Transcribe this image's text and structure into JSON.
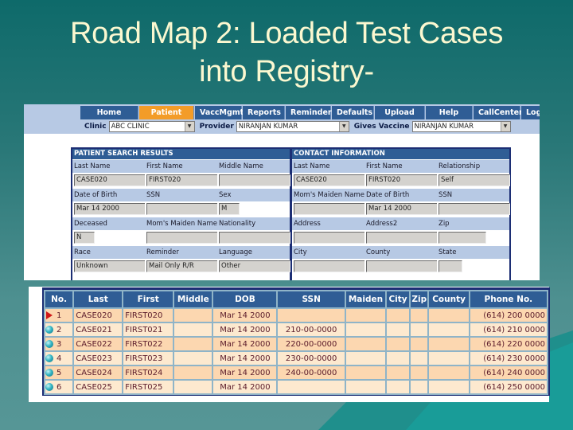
{
  "slide": {
    "title_line1": "Road Map 2: Loaded Test Cases",
    "title_line2": "into Registry-"
  },
  "app": {
    "nav": [
      {
        "label": "Home",
        "active": false
      },
      {
        "label": "Patient",
        "active": true
      },
      {
        "label": "VaccMgmt",
        "active": false
      },
      {
        "label": "Reports",
        "active": false
      },
      {
        "label": "Reminder",
        "active": false
      },
      {
        "label": "Defaults",
        "active": false
      },
      {
        "label": "Upload",
        "active": false
      },
      {
        "label": "Help",
        "active": false
      },
      {
        "label": "CallCenter",
        "active": false
      },
      {
        "label": "Logout",
        "active": false
      }
    ],
    "filters": {
      "clinic_label": "Clinic",
      "clinic_value": "ABC CLINIC",
      "provider_label": "Provider",
      "provider_value": "NIRANJAN KUMAR",
      "gives_vaccine_label": "Gives Vaccine",
      "gives_vaccine_value": "NIRANJAN KUMAR"
    },
    "patient_panel": {
      "title": "PATIENT SEARCH RESULTS",
      "rows": [
        {
          "labels": [
            "Last Name",
            "First Name",
            "Middle Name"
          ],
          "values": [
            "CASE020",
            "FIRST020",
            ""
          ]
        },
        {
          "labels": [
            "Date of Birth",
            "SSN",
            "Sex"
          ],
          "values": [
            "Mar 14 2000",
            "",
            "M"
          ]
        },
        {
          "labels": [
            "Deceased",
            "Mom's Maiden Name",
            "Nationality"
          ],
          "values": [
            "N",
            "",
            ""
          ]
        },
        {
          "labels": [
            "Race",
            "Reminder",
            "Language"
          ],
          "values": [
            "Unknown",
            "Mail Only R/R",
            "Other"
          ]
        }
      ]
    },
    "contact_panel": {
      "title": "CONTACT INFORMATION",
      "rows": [
        {
          "labels": [
            "Last Name",
            "First Name",
            "Relationship"
          ],
          "values": [
            "CASE020",
            "FIRST020",
            "Self"
          ]
        },
        {
          "labels": [
            "Mom's Maiden Name",
            "Date of Birth",
            "SSN"
          ],
          "values": [
            "",
            "Mar 14 2000",
            ""
          ]
        },
        {
          "labels": [
            "Address",
            "Address2",
            "Zip"
          ],
          "values": [
            "",
            "",
            ""
          ]
        },
        {
          "labels": [
            "City",
            "County",
            "State"
          ],
          "values": [
            "",
            "",
            ""
          ]
        }
      ]
    },
    "results_table": {
      "columns": [
        "No.",
        "Last",
        "First",
        "Middle",
        "DOB",
        "SSN",
        "Maiden",
        "City",
        "Zip",
        "County",
        "Phone No."
      ],
      "rows": [
        {
          "marker": "selected-arrow-icon",
          "no": "1",
          "last": "CASE020",
          "first": "FIRST020",
          "middle": "",
          "dob": "Mar 14 2000",
          "ssn": "",
          "maiden": "",
          "city": "",
          "zip": "",
          "county": "",
          "phone": "(614) 200 0000"
        },
        {
          "marker": "ball-icon",
          "no": "2",
          "last": "CASE021",
          "first": "FIRST021",
          "middle": "",
          "dob": "Mar 14 2000",
          "ssn": "210-00-0000",
          "maiden": "",
          "city": "",
          "zip": "",
          "county": "",
          "phone": "(614) 210 0000"
        },
        {
          "marker": "ball-icon",
          "no": "3",
          "last": "CASE022",
          "first": "FIRST022",
          "middle": "",
          "dob": "Mar 14 2000",
          "ssn": "220-00-0000",
          "maiden": "",
          "city": "",
          "zip": "",
          "county": "",
          "phone": "(614) 220 0000"
        },
        {
          "marker": "ball-icon",
          "no": "4",
          "last": "CASE023",
          "first": "FIRST023",
          "middle": "",
          "dob": "Mar 14 2000",
          "ssn": "230-00-0000",
          "maiden": "",
          "city": "",
          "zip": "",
          "county": "",
          "phone": "(614) 230 0000"
        },
        {
          "marker": "ball-icon",
          "no": "5",
          "last": "CASE024",
          "first": "FIRST024",
          "middle": "",
          "dob": "Mar 14 2000",
          "ssn": "240-00-0000",
          "maiden": "",
          "city": "",
          "zip": "",
          "county": "",
          "phone": "(614) 240 0000"
        },
        {
          "marker": "ball-icon",
          "no": "6",
          "last": "CASE025",
          "first": "FIRST025",
          "middle": "",
          "dob": "Mar 14 2000",
          "ssn": "",
          "maiden": "",
          "city": "",
          "zip": "",
          "county": "",
          "phone": "(614) 250 0000"
        }
      ]
    }
  }
}
